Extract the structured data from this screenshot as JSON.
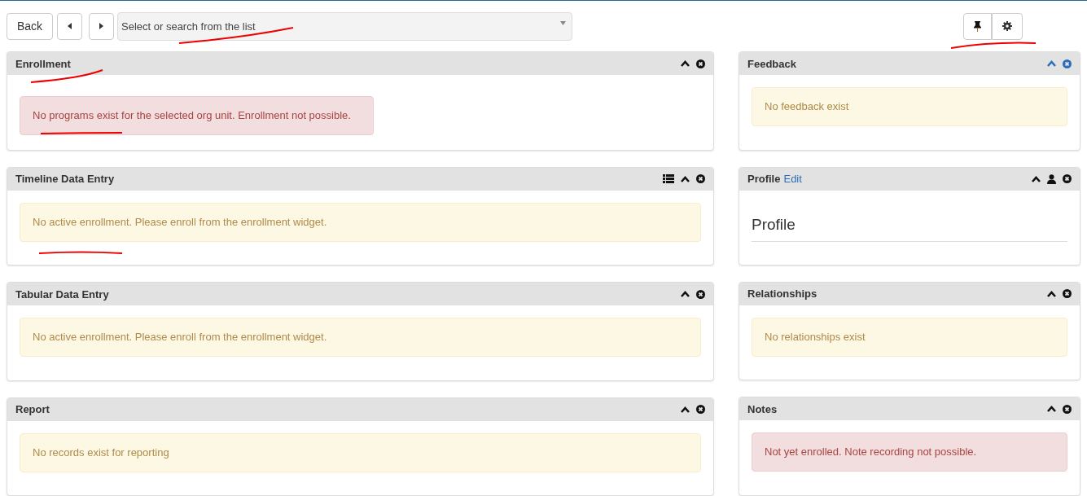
{
  "toolbar": {
    "back_label": "Back",
    "select": {
      "placeholder": "Select or search from the list"
    }
  },
  "left_column": [
    {
      "title": "Enrollment",
      "highlighted": false,
      "tools": [
        {
          "kind": "collapse"
        },
        {
          "kind": "close"
        }
      ],
      "body": {
        "kind": "danger",
        "compact": true,
        "text": "No programs exist for the selected org unit. Enrollment not possible."
      }
    },
    {
      "title": "Timeline Data Entry",
      "highlighted": false,
      "tools": [
        {
          "kind": "list"
        },
        {
          "kind": "collapse"
        },
        {
          "kind": "close"
        }
      ],
      "body": {
        "kind": "warning",
        "compact": false,
        "text": "No active enrollment. Please enroll from the enrollment widget."
      }
    },
    {
      "title": "Tabular Data Entry",
      "highlighted": false,
      "tools": [
        {
          "kind": "collapse"
        },
        {
          "kind": "close"
        }
      ],
      "body": {
        "kind": "warning",
        "compact": false,
        "text": "No active enrollment. Please enroll from the enrollment widget."
      }
    },
    {
      "title": "Report",
      "highlighted": false,
      "tools": [
        {
          "kind": "collapse"
        },
        {
          "kind": "close"
        }
      ],
      "body": {
        "kind": "warning",
        "compact": false,
        "text": "No records exist for reporting"
      }
    }
  ],
  "right_column": [
    {
      "title": "Feedback",
      "highlighted": true,
      "tools": [
        {
          "kind": "collapse"
        },
        {
          "kind": "close"
        }
      ],
      "body": {
        "kind": "warning",
        "compact": false,
        "text": "No feedback exist"
      }
    },
    {
      "title": "Profile",
      "edit_link": "Edit",
      "highlighted": false,
      "tools": [
        {
          "kind": "collapse"
        },
        {
          "kind": "user"
        },
        {
          "kind": "close"
        }
      ],
      "body": {
        "kind": "heading",
        "text": "Profile"
      }
    },
    {
      "title": "Relationships",
      "highlighted": false,
      "tools": [
        {
          "kind": "collapse"
        },
        {
          "kind": "close"
        }
      ],
      "body": {
        "kind": "warning",
        "compact": false,
        "text": "No relationships exist"
      }
    },
    {
      "title": "Notes",
      "highlighted": false,
      "tools": [
        {
          "kind": "collapse"
        },
        {
          "kind": "close"
        }
      ],
      "body": {
        "kind": "danger",
        "compact": false,
        "text": "Not yet enrolled. Note recording not possible."
      }
    }
  ]
}
